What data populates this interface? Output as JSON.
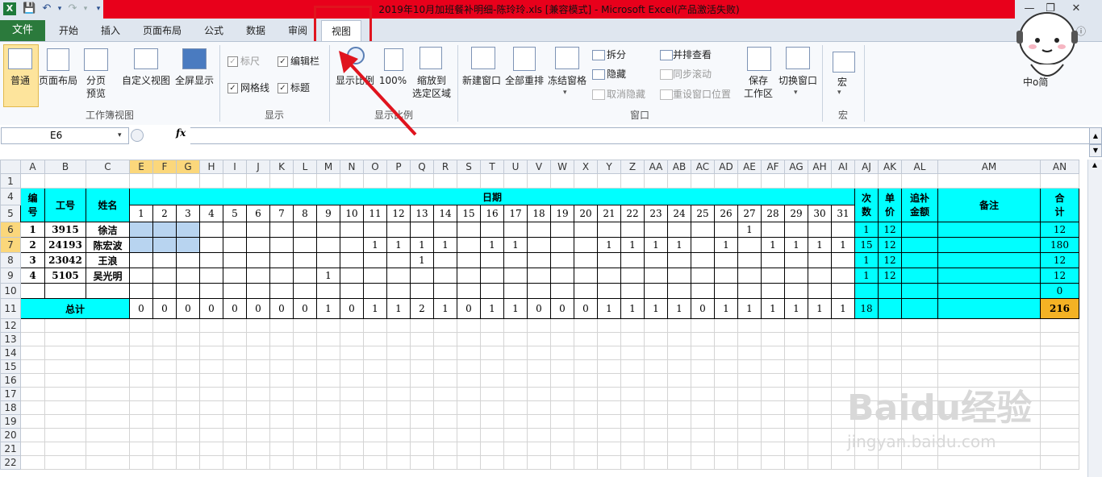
{
  "window": {
    "title": "2019年10月加班餐补明细-陈玲玲.xls  [兼容模式]  -  Microsoft Excel(产品激活失败)"
  },
  "tabs": [
    "文件",
    "开始",
    "插入",
    "页面布局",
    "公式",
    "数据",
    "审阅",
    "视图"
  ],
  "ribbon": {
    "workbook_views": {
      "label": "工作簿视图",
      "items": [
        "普通",
        "页面布局",
        "分页\n预览",
        "自定义视图",
        "全屏显示"
      ]
    },
    "show": {
      "label": "显示",
      "items": [
        {
          "text": "标尺",
          "checked": true,
          "enabled": false
        },
        {
          "text": "编辑栏",
          "checked": true,
          "enabled": true
        },
        {
          "text": "网格线",
          "checked": true,
          "enabled": true
        },
        {
          "text": "标题",
          "checked": true,
          "enabled": true
        }
      ]
    },
    "zoom": {
      "label": "显示比例",
      "items": [
        "显示比例",
        "100%",
        "缩放到\n选定区域"
      ]
    },
    "window": {
      "label": "窗口",
      "items": [
        "新建窗口",
        "全部重排",
        "冻结窗格",
        "拆分",
        "隐藏",
        "取消隐藏",
        "并排查看",
        "同步滚动",
        "重设窗口位置",
        "保存\n工作区",
        "切换窗口"
      ]
    },
    "macro": {
      "label": "宏",
      "items": [
        "宏"
      ]
    }
  },
  "formula_bar": {
    "name_box": "E6",
    "fx": "fx",
    "value": ""
  },
  "sheet": {
    "col_headers": [
      "A",
      "B",
      "C",
      "E",
      "F",
      "G",
      "H",
      "I",
      "J",
      "K",
      "L",
      "M",
      "N",
      "O",
      "P",
      "Q",
      "R",
      "S",
      "T",
      "U",
      "V",
      "W",
      "X",
      "Y",
      "Z",
      "AA",
      "AB",
      "AC",
      "AD",
      "AE",
      "AF",
      "AG",
      "AH",
      "AI",
      "AJ",
      "AK",
      "AL",
      "AM",
      "AN"
    ],
    "row_headers": [
      "1",
      "4",
      "5",
      "6",
      "7",
      "8",
      "9",
      "10",
      "11",
      "12",
      "13",
      "14",
      "15",
      "16",
      "17",
      "18",
      "19",
      "20",
      "21",
      "22"
    ],
    "header": {
      "id": "编\n号",
      "emp_no": "工号",
      "name": "姓名",
      "date": "日期",
      "count": "次\n数",
      "price": "单\n价",
      "extra": "追补\n金额",
      "remark": "备注",
      "total": "合\n计"
    },
    "days": [
      "1",
      "2",
      "3",
      "4",
      "5",
      "6",
      "7",
      "8",
      "9",
      "10",
      "11",
      "12",
      "13",
      "14",
      "15",
      "16",
      "17",
      "18",
      "19",
      "20",
      "21",
      "22",
      "23",
      "24",
      "25",
      "26",
      "27",
      "28",
      "29",
      "30",
      "31"
    ],
    "rows": [
      {
        "id": "1",
        "emp_no": "3915",
        "name": "徐洁",
        "marks": [
          "",
          "",
          "",
          "",
          "",
          "",
          "",
          "",
          "",
          "",
          "",
          "",
          "",
          "",
          "",
          "",
          "",
          "",
          "",
          "",
          "",
          "",
          "",
          "",
          "",
          "",
          "1",
          "",
          "",
          "",
          ""
        ],
        "count": "1",
        "price": "12",
        "extra": "",
        "remark": "",
        "total": "12"
      },
      {
        "id": "2",
        "emp_no": "24193",
        "name": "陈宏波",
        "marks": [
          "",
          "",
          "",
          "",
          "",
          "",
          "",
          "",
          "",
          "",
          "1",
          "1",
          "1",
          "1",
          "",
          "1",
          "1",
          "",
          "",
          "",
          "1",
          "1",
          "1",
          "1",
          "",
          "1",
          "",
          "1",
          "1",
          "1",
          "1"
        ],
        "count": "15",
        "price": "12",
        "extra": "",
        "remark": "",
        "total": "180"
      },
      {
        "id": "3",
        "emp_no": "23042",
        "name": "王浪",
        "marks": [
          "",
          "",
          "",
          "",
          "",
          "",
          "",
          "",
          "",
          "",
          "",
          "",
          "1",
          "",
          "",
          "",
          "",
          "",
          "",
          "",
          "",
          "",
          "",
          "",
          "",
          "",
          "",
          "",
          "",
          "",
          ""
        ],
        "count": "1",
        "price": "12",
        "extra": "",
        "remark": "",
        "total": "12"
      },
      {
        "id": "4",
        "emp_no": "5105",
        "name": "吴光明",
        "marks": [
          "",
          "",
          "",
          "",
          "",
          "",
          "",
          "",
          "1",
          "",
          "",
          "",
          "",
          "",
          "",
          "",
          "",
          "",
          "",
          "",
          "",
          "",
          "",
          "",
          "",
          "",
          "",
          "",
          "",
          "",
          ""
        ],
        "count": "1",
        "price": "12",
        "extra": "",
        "remark": "",
        "total": "12"
      },
      {
        "id": "",
        "emp_no": "",
        "name": "",
        "marks": [
          "",
          "",
          "",
          "",
          "",
          "",
          "",
          "",
          "",
          "",
          "",
          "",
          "",
          "",
          "",
          "",
          "",
          "",
          "",
          "",
          "",
          "",
          "",
          "",
          "",
          "",
          "",
          "",
          "",
          "",
          ""
        ],
        "count": "",
        "price": "",
        "extra": "",
        "remark": "",
        "total": "0"
      }
    ],
    "totals": {
      "label": "总计",
      "days": [
        "0",
        "0",
        "0",
        "0",
        "0",
        "0",
        "0",
        "0",
        "1",
        "0",
        "1",
        "1",
        "2",
        "1",
        "0",
        "1",
        "1",
        "0",
        "0",
        "0",
        "1",
        "1",
        "1",
        "1",
        "0",
        "1",
        "1",
        "1",
        "1",
        "1",
        "1"
      ],
      "count": "18",
      "price": "",
      "extra": "",
      "remark": "",
      "total": "216"
    }
  },
  "watermark": {
    "line1": "Baidu经验",
    "line2": "jingyan.baidu.com"
  },
  "avatar": {
    "text": "中o简"
  }
}
